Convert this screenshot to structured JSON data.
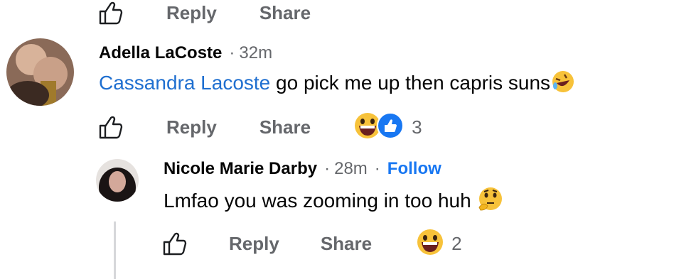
{
  "top_actions": {
    "reply": "Reply",
    "share": "Share"
  },
  "comment1": {
    "author": "Adella LaCoste",
    "separator": "·",
    "time": "32m",
    "mention": "Cassandra Lacoste",
    "text": "go pick me up then capris suns",
    "reply": "Reply",
    "share": "Share",
    "reaction_count": "3"
  },
  "comment2": {
    "author": "Nicole Marie Darby",
    "separator": "·",
    "time": "28m",
    "separator2": "·",
    "follow": "Follow",
    "text": "Lmfao you was zooming in too huh",
    "reply": "Reply",
    "share": "Share",
    "reaction_count": "2"
  },
  "colors": {
    "link": "#1f6fd0",
    "follow": "#1877f2",
    "muted": "#65676b",
    "text": "#050505",
    "thread_line": "#d6d7da"
  }
}
